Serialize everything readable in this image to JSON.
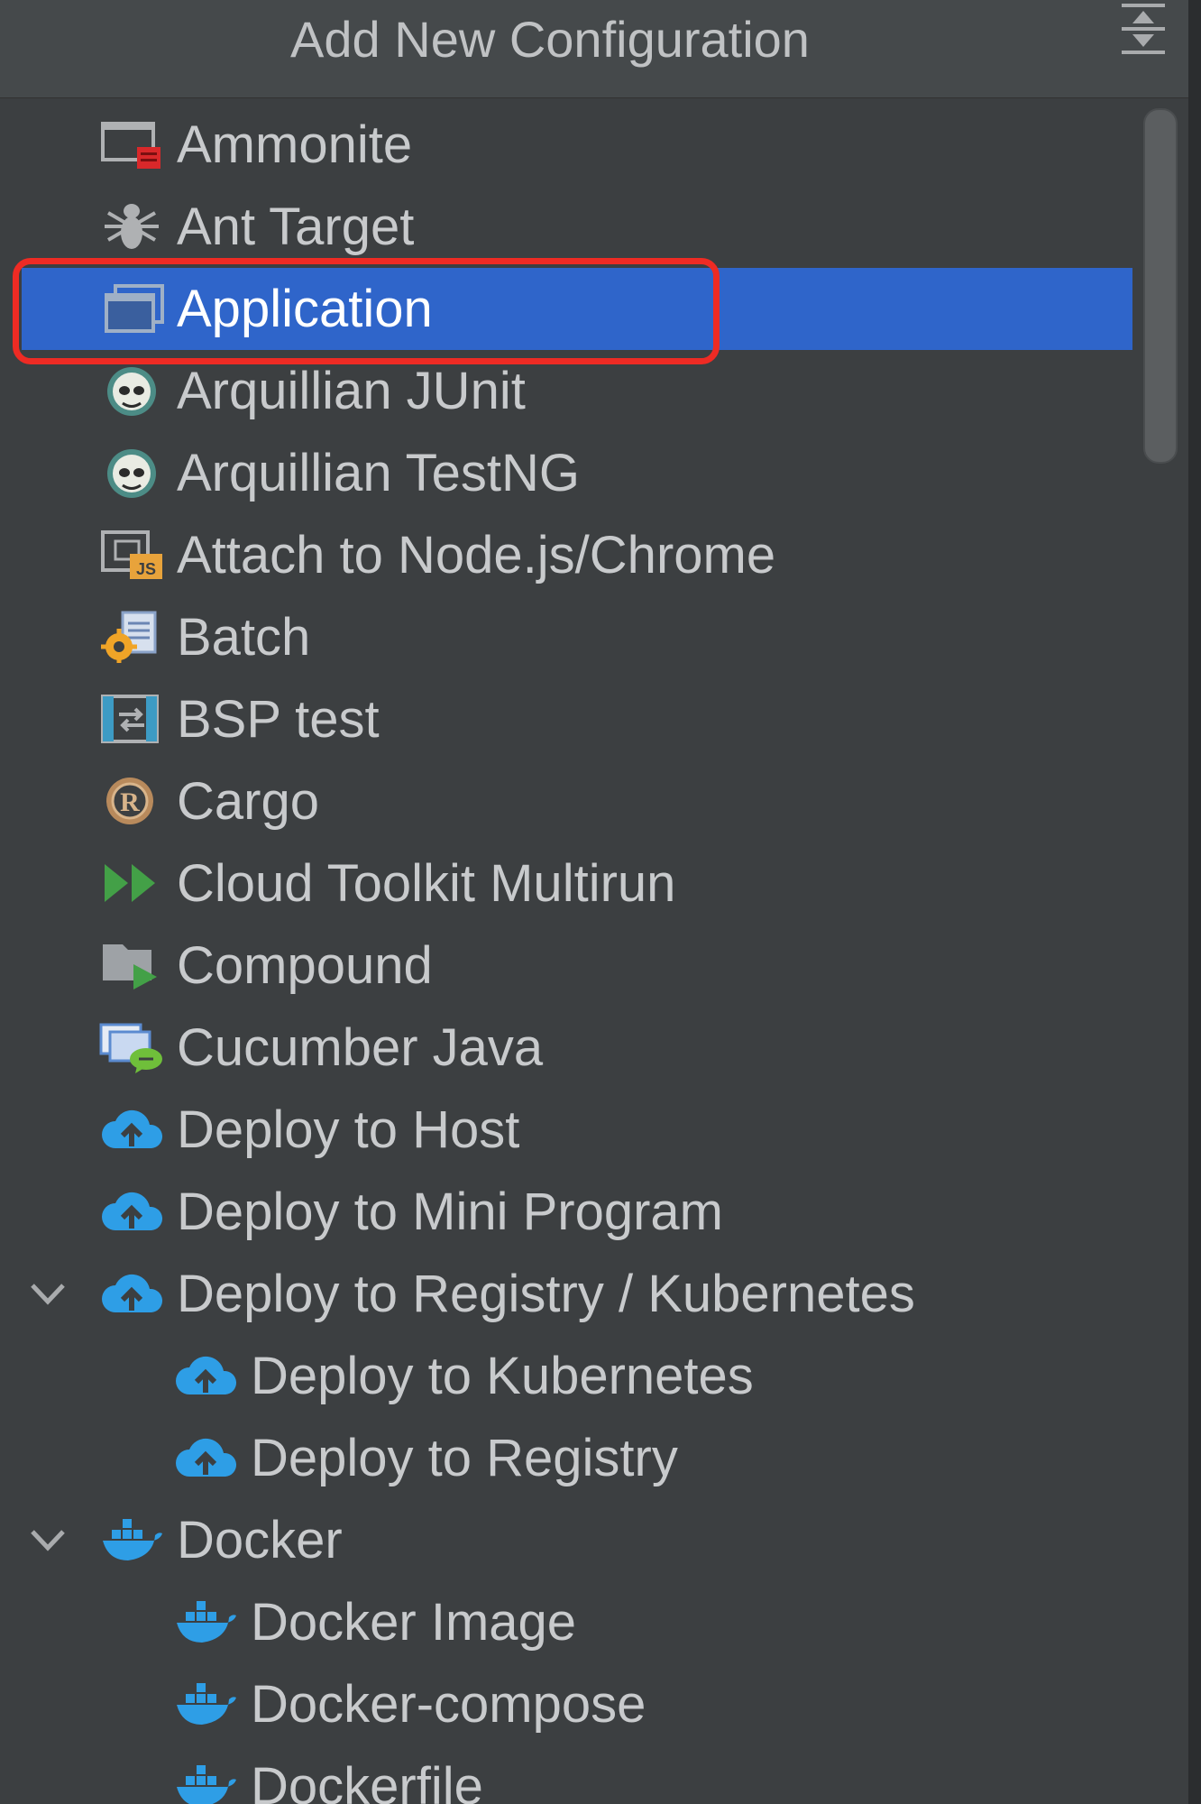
{
  "header": {
    "title": "Add New Configuration"
  },
  "items": [
    {
      "label": "Ammonite",
      "icon": "ammonite-icon"
    },
    {
      "label": "Ant Target",
      "icon": "ant-icon"
    },
    {
      "label": "Application",
      "icon": "application-icon",
      "selected": true
    },
    {
      "label": "Arquillian JUnit",
      "icon": "arquillian-icon"
    },
    {
      "label": "Arquillian TestNG",
      "icon": "arquillian-icon"
    },
    {
      "label": "Attach to Node.js/Chrome",
      "icon": "nodejs-attach-icon"
    },
    {
      "label": "Batch",
      "icon": "batch-icon"
    },
    {
      "label": "BSP test",
      "icon": "bsp-icon"
    },
    {
      "label": "Cargo",
      "icon": "cargo-icon"
    },
    {
      "label": "Cloud Toolkit Multirun",
      "icon": "multirun-icon"
    },
    {
      "label": "Compound",
      "icon": "compound-icon"
    },
    {
      "label": "Cucumber Java",
      "icon": "cucumber-icon"
    },
    {
      "label": "Deploy to Host",
      "icon": "cloud-upload-icon"
    },
    {
      "label": "Deploy to Mini Program",
      "icon": "cloud-upload-icon"
    },
    {
      "label": "Deploy to Registry / Kubernetes",
      "icon": "cloud-upload-icon",
      "expanded": true
    },
    {
      "label": "Deploy to Kubernetes",
      "icon": "cloud-upload-icon",
      "child": true
    },
    {
      "label": "Deploy to Registry",
      "icon": "cloud-upload-icon",
      "child": true
    },
    {
      "label": "Docker",
      "icon": "docker-icon",
      "expanded": true
    },
    {
      "label": "Docker Image",
      "icon": "docker-icon",
      "child": true
    },
    {
      "label": "Docker-compose",
      "icon": "docker-icon",
      "child": true
    },
    {
      "label": "Dockerfile",
      "icon": "docker-icon",
      "child": true
    }
  ],
  "colors": {
    "background": "#3c3f41",
    "selection": "#2f65ca",
    "highlight_border": "#ee2b24",
    "text": "#c8cacc"
  }
}
